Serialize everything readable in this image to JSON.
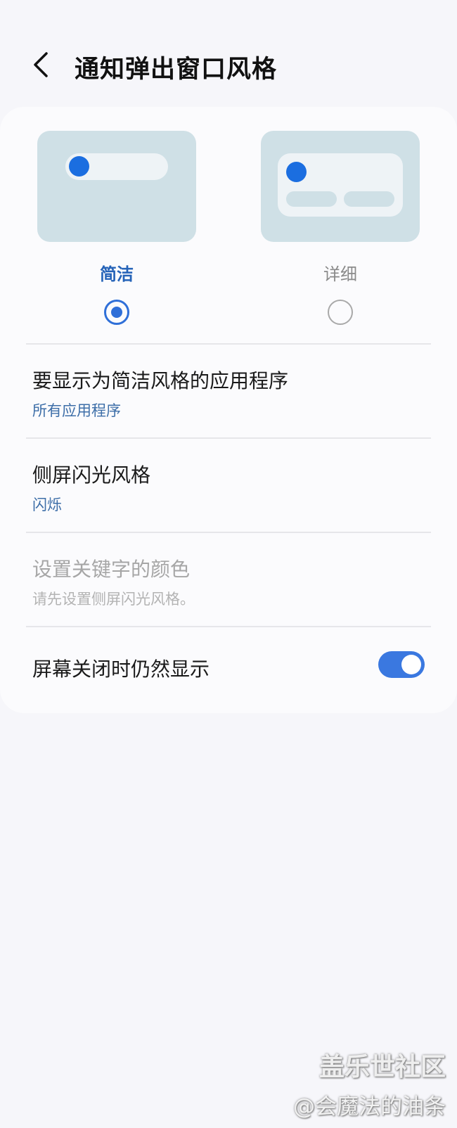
{
  "header": {
    "title": "通知弹出窗口风格"
  },
  "style_options": [
    {
      "label": "简洁",
      "selected": true
    },
    {
      "label": "详细",
      "selected": false
    }
  ],
  "settings": {
    "simple_apps": {
      "title": "要显示为简洁风格的应用程序",
      "value": "所有应用程序"
    },
    "edge_flash": {
      "title": "侧屏闪光风格",
      "value": "闪烁"
    },
    "keyword_color": {
      "title": "设置关键字的颜色",
      "value": "请先设置侧屏闪光风格。",
      "enabled": false
    },
    "show_when_off": {
      "title": "屏幕关闭时仍然显示",
      "on": true
    }
  },
  "colors": {
    "accent": "#3a78e0",
    "link": "#3d6ea8",
    "preview_bg": "#cfe0e6",
    "dot": "#1b6ee0"
  },
  "watermark": {
    "line1": "盖乐世社区",
    "line2": "@会魔法的油条"
  }
}
